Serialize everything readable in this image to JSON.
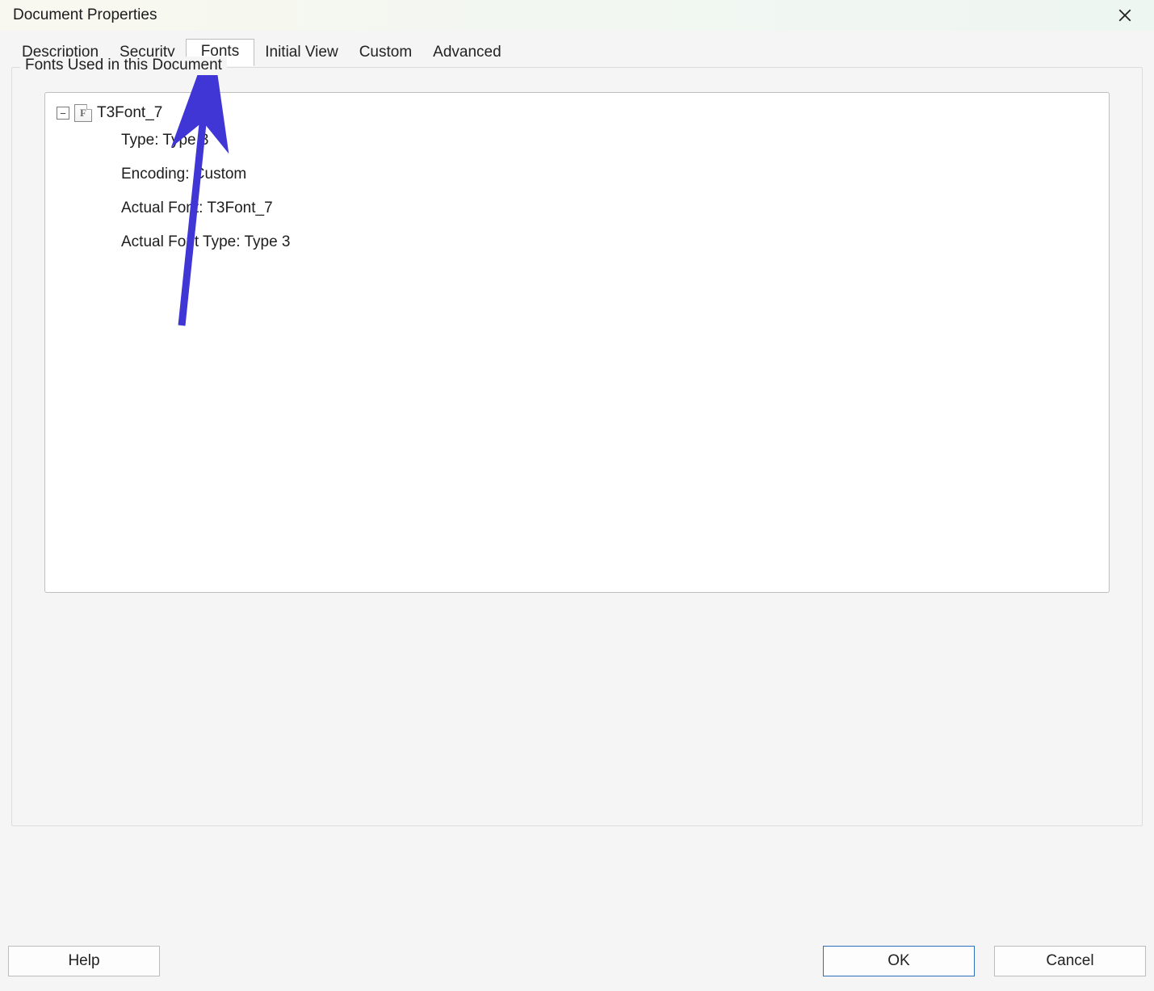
{
  "window": {
    "title": "Document Properties"
  },
  "tabs": {
    "description": "Description",
    "security": "Security",
    "fonts": "Fonts",
    "initial_view": "Initial View",
    "custom": "Custom",
    "advanced": "Advanced",
    "active": "fonts"
  },
  "group": {
    "title": "Fonts Used in this Document"
  },
  "font_entry": {
    "name": "T3Font_7",
    "expanded": true,
    "props": {
      "type": "Type: Type 3",
      "encoding": "Encoding: Custom",
      "actual_font": "Actual Font: T3Font_7",
      "actual_font_type": "Actual Font Type: Type 3"
    }
  },
  "buttons": {
    "help": "Help",
    "ok": "OK",
    "cancel": "Cancel"
  },
  "arrow": {
    "color": "#4036d6"
  }
}
